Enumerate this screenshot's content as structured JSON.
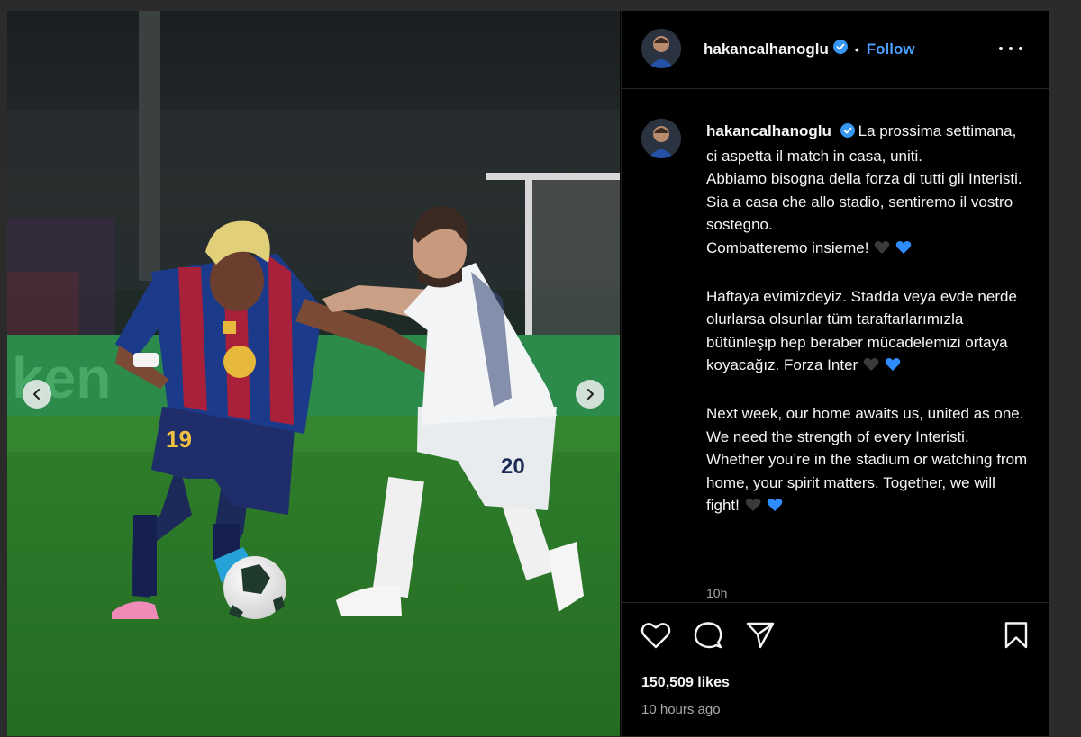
{
  "post": {
    "username": "hakancalhanoglu",
    "header_separator": "•",
    "follow_label": "Follow",
    "caption": {
      "it_lines": [
        "La prossima settimana, ci aspetta il match in casa, uniti.",
        "Abbiamo bisogna della forza di tutti gli Interisti.",
        "Sia a casa che allo stadio, sentiremo il vostro sostegno.",
        "Combatteremo insieme!"
      ],
      "tr_text": "Haftaya evimizdeyiz. Stadda veya evde nerde olurlarsa olsunlar tüm taraftarlarımızla bütünleşip hep beraber mücadelemizi ortaya koyacağız. Forza Inter",
      "en_text": "Next week, our home awaits us, united as one. We need the strength of every Interisti. Whether you’re in the stadium or watching from home, your spirit matters. Together, we will fight!"
    },
    "caption_time": "10h",
    "likes": "150,509 likes",
    "time_ago": "10 hours ago",
    "heart_colors": {
      "black": "#3a3a3a",
      "blue": "#2f8cff"
    }
  },
  "photo": {
    "player_left_number": "19",
    "player_right_number": "20"
  },
  "icons": {
    "prev": "chevron-left-icon",
    "next": "chevron-right-icon",
    "like": "heart-outline-icon",
    "comment": "comment-bubble-icon",
    "share": "paper-plane-icon",
    "save": "bookmark-icon",
    "more": "more-dots-icon",
    "verified": "verified-badge-icon"
  },
  "colors": {
    "link_blue": "#4a9eff",
    "verified_blue": "#3897f0",
    "muted_text": "#a8a8a8",
    "pitch_green": "#2f7a2c"
  }
}
